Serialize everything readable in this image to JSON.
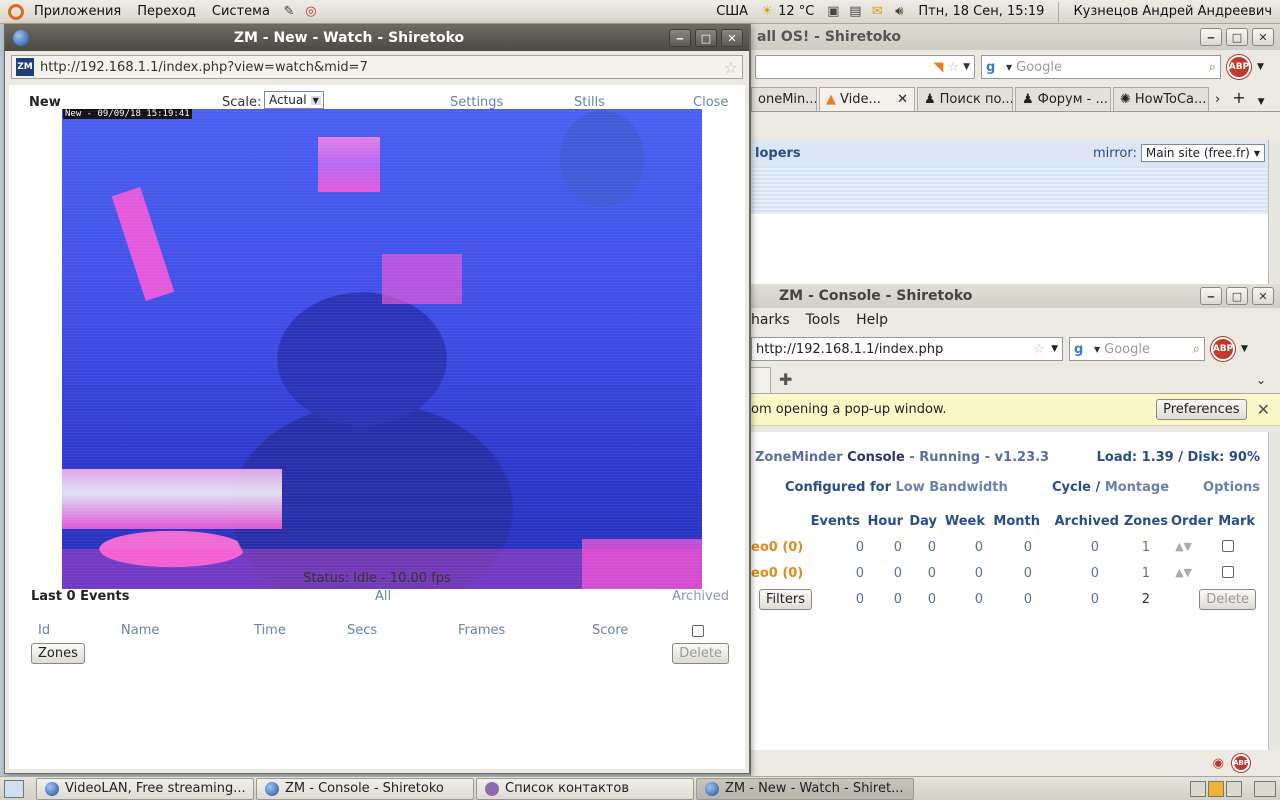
{
  "top_panel": {
    "menus": [
      "Приложения",
      "Переход",
      "Система"
    ],
    "keyboard_layout": "США",
    "weather": "12 °C",
    "datetime": "Птн, 18 Сен, 15:19",
    "user": "Кузнецов Андрей Андреевич"
  },
  "bg_browser": {
    "title": "all OS! - Shiretoko",
    "search_placeholder": "Google",
    "abp_label": "ABP",
    "tabs": [
      "oneMin...",
      "Vide...",
      "Поиск по...",
      "Форум - ...",
      "HowToCa..."
    ],
    "bluebar_left": "lopers",
    "mirror_label": "mirror:",
    "mirror_value": "Main site (free.fr)"
  },
  "console": {
    "title": "ZM - Console - Shiretoko",
    "menu": [
      "harks",
      "Tools",
      "Help"
    ],
    "url": "http://192.168.1.1/index.php",
    "search_placeholder": "Google",
    "popup_msg": "om opening a pop-up window.",
    "preferences_btn": "Preferences",
    "app_name": "ZoneMinder",
    "console_word": "Console",
    "dash1": "-",
    "running": "Running",
    "dash2": "-",
    "version": "v1.23.3",
    "load_disk": "Load: 1.39 / Disk: 90%",
    "configured_for": "Configured for",
    "bandwidth": "Low Bandwidth",
    "cycle": "Cycle",
    "slash": "/",
    "montage": "Montage",
    "options": "Options",
    "columns": [
      "Events",
      "Hour",
      "Day",
      "Week",
      "Month",
      "Archived",
      "Zones",
      "Order",
      "Mark"
    ],
    "rows": [
      {
        "name": "eo0 (0)",
        "values": [
          "0",
          "0",
          "0",
          "0",
          "0",
          "0",
          "1"
        ]
      },
      {
        "name": "eo0 (0)",
        "values": [
          "0",
          "0",
          "0",
          "0",
          "0",
          "0",
          "1"
        ]
      }
    ],
    "totals": {
      "filters_btn": "Filters",
      "values": [
        "0",
        "0",
        "0",
        "0",
        "0",
        "0",
        "2"
      ],
      "delete_btn": "Delete"
    }
  },
  "watch": {
    "title": "ZM - New - Watch - Shiretoko",
    "url": "http://192.168.1.1/index.php?view=watch&mid=7",
    "favicon": "ZM",
    "monitor_name": "New",
    "scale_label": "Scale:",
    "scale_value": "Actual",
    "settings": "Settings",
    "stills": "Stills",
    "close": "Close",
    "timestamp": "New - 09/09/18 15:19:41",
    "status": "Status: Idle - 10.00 fps",
    "last_events": "Last 0 Events",
    "all": "All",
    "archived": "Archived",
    "columns": [
      "Id",
      "Name",
      "Time",
      "Secs",
      "Frames",
      "Score"
    ],
    "zones_btn": "Zones",
    "delete_btn": "Delete"
  },
  "taskbar": {
    "tasks": [
      "VideoLAN, Free streaming...",
      "ZM - Console - Shiretoko",
      "Список контактов",
      "ZM - New - Watch - Shiret..."
    ]
  }
}
